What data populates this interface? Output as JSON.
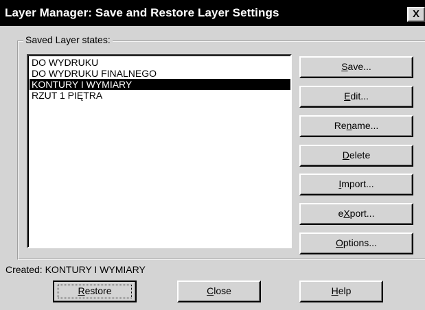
{
  "window": {
    "title": "Layer Manager: Save and Restore Layer Settings",
    "close_label": "X"
  },
  "group": {
    "label": "Saved Layer states:"
  },
  "layer_states": [
    {
      "label": "DO WYDRUKU",
      "selected": false
    },
    {
      "label": "DO WYDRUKU FINALNEGO",
      "selected": false
    },
    {
      "label": "KONTURY I WYMIARY",
      "selected": true
    },
    {
      "label": "RZUT 1 PIĘTRA",
      "selected": false
    }
  ],
  "side_buttons": [
    {
      "id": "save",
      "pre": "",
      "key": "S",
      "post": "ave..."
    },
    {
      "id": "edit",
      "pre": "",
      "key": "E",
      "post": "dit..."
    },
    {
      "id": "rename",
      "pre": "Re",
      "key": "n",
      "post": "ame..."
    },
    {
      "id": "delete",
      "pre": "",
      "key": "D",
      "post": "elete"
    },
    {
      "id": "import",
      "pre": "",
      "key": "I",
      "post": "mport..."
    },
    {
      "id": "export",
      "pre": "e",
      "key": "X",
      "post": "port..."
    },
    {
      "id": "options",
      "pre": "",
      "key": "O",
      "post": "ptions..."
    }
  ],
  "status": {
    "created_text": "Created: KONTURY I WYMIARY"
  },
  "bottom_buttons": [
    {
      "id": "restore",
      "pre": "",
      "key": "R",
      "post": "estore"
    },
    {
      "id": "close",
      "pre": "",
      "key": "C",
      "post": "lose"
    },
    {
      "id": "help",
      "pre": "",
      "key": "H",
      "post": "elp"
    }
  ]
}
